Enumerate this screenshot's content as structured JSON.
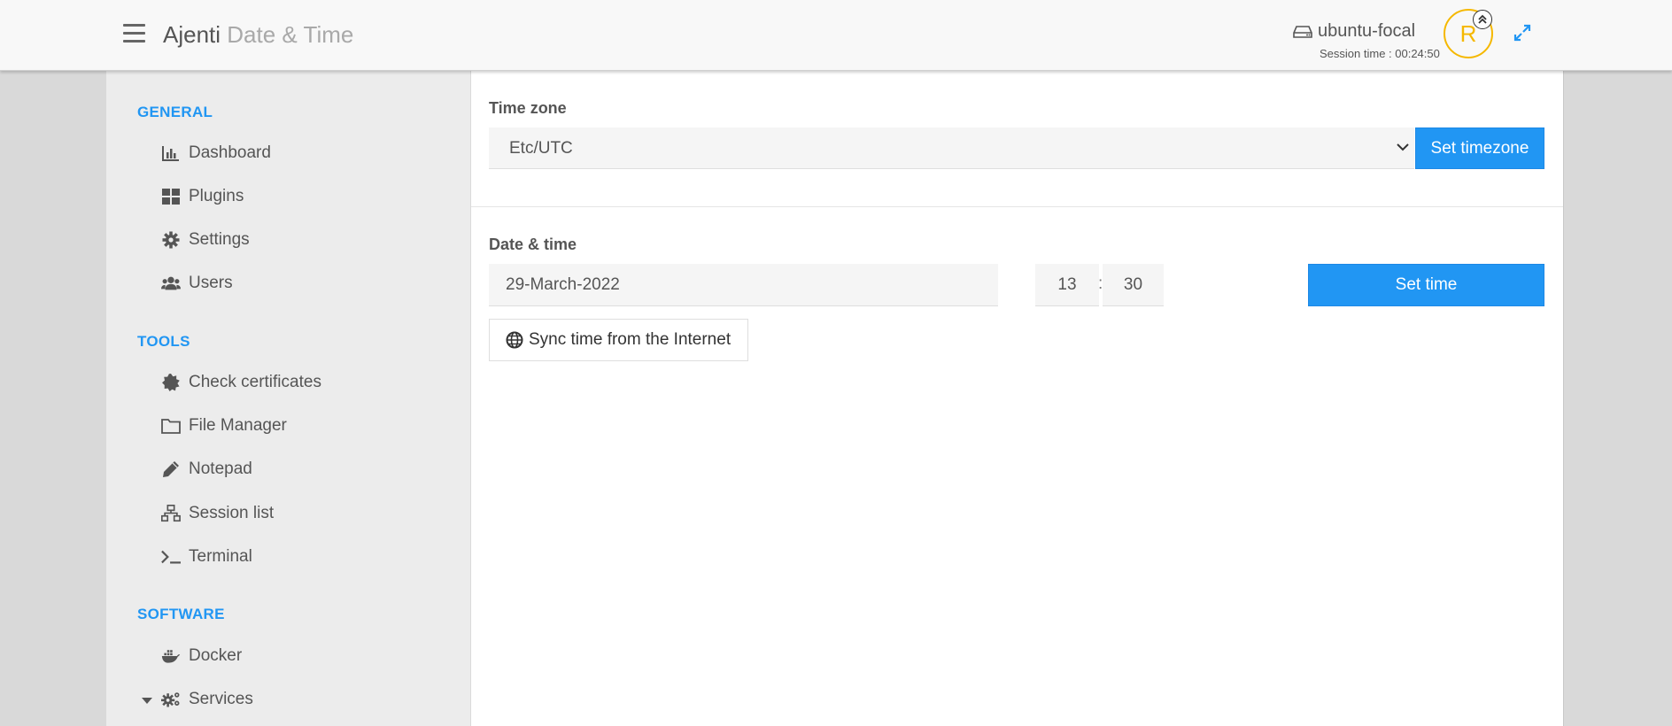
{
  "header": {
    "app_name": "Ajenti",
    "page_title": "Date & Time",
    "hostname": "ubuntu-focal",
    "session_time": "Session time : 00:24:50",
    "avatar_letter": "R"
  },
  "sidebar": {
    "sections": [
      {
        "title": "GENERAL",
        "items": [
          {
            "label": "Dashboard",
            "icon": "bar-chart-icon"
          },
          {
            "label": "Plugins",
            "icon": "grid-icon"
          },
          {
            "label": "Settings",
            "icon": "gear-icon"
          },
          {
            "label": "Users",
            "icon": "users-icon"
          }
        ]
      },
      {
        "title": "TOOLS",
        "items": [
          {
            "label": "Check certificates",
            "icon": "certificate-icon"
          },
          {
            "label": "File Manager",
            "icon": "folder-icon"
          },
          {
            "label": "Notepad",
            "icon": "pencil-icon"
          },
          {
            "label": "Session list",
            "icon": "sitemap-icon"
          },
          {
            "label": "Terminal",
            "icon": "terminal-icon"
          }
        ]
      },
      {
        "title": "SOFTWARE",
        "items": [
          {
            "label": "Docker",
            "icon": "docker-icon"
          },
          {
            "label": "Services",
            "icon": "cogs-icon"
          }
        ]
      }
    ]
  },
  "main": {
    "timezone_label": "Time zone",
    "timezone_value": "Etc/UTC",
    "set_timezone_label": "Set timezone",
    "datetime_label": "Date & time",
    "date_value": "29-March-2022",
    "hour_value": "13",
    "time_separator": ":",
    "minute_value": "30",
    "set_time_label": "Set time",
    "sync_label": "Sync time from the Internet"
  },
  "colors": {
    "accent": "#2196f3",
    "avatar": "#f5b800"
  }
}
